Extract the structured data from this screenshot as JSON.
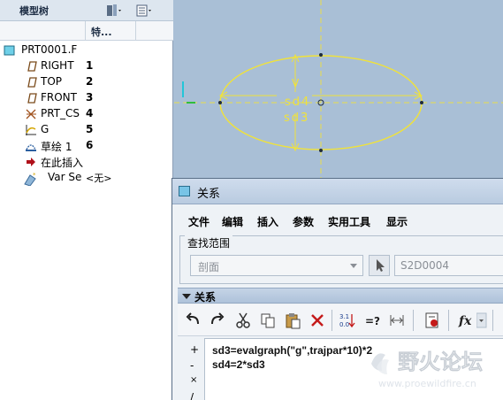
{
  "model_tree": {
    "title": "模型树",
    "column_header": "特...",
    "root": {
      "label": "PRT0001.F",
      "icon": "part-icon"
    },
    "rows": [
      {
        "name": "RIGHT",
        "value": "1",
        "icon": "datum-plane-icon"
      },
      {
        "name": "TOP",
        "value": "2",
        "icon": "datum-plane-icon"
      },
      {
        "name": "FRONT",
        "value": "3",
        "icon": "datum-plane-icon"
      },
      {
        "name": "PRT_CS",
        "value": "4",
        "icon": "coordinate-system-icon"
      },
      {
        "name": "G",
        "value": "5",
        "icon": "graph-icon"
      },
      {
        "name": "草绘 1",
        "value": "6",
        "icon": "sketch-icon"
      },
      {
        "name": "在此插入",
        "value": "",
        "icon": "insert-here-arrow-icon"
      },
      {
        "name": "Var Se",
        "value": "<无>",
        "icon": "variable-section-sweep-icon"
      }
    ]
  },
  "graphics": {
    "sketch_color": "#f0e23a",
    "dim_labels": [
      "sd4",
      "sd3"
    ],
    "axis_label": "V"
  },
  "dialog": {
    "title": "关系",
    "menu": [
      "文件",
      "编辑",
      "插入",
      "参数",
      "实用工具",
      "显示"
    ],
    "scope": {
      "group_label": "查找范围",
      "select_value": "剖面",
      "field_value": "S2D0004"
    },
    "relations_header": "关系",
    "toolbar_icons": [
      "undo-icon",
      "redo-icon",
      "cut-icon",
      "copy-icon",
      "paste-icon",
      "delete-icon",
      "sort-relations-icon",
      "evaluate-icon",
      "measure-icon",
      "verify-icon",
      "function-icon"
    ],
    "side_buttons": [
      "+",
      "-",
      "×",
      "/"
    ],
    "code_lines": [
      "sd3=evalgraph(\"g\",trajpar*10)*2",
      "sd4=2*sd3"
    ]
  },
  "watermark": {
    "title": "野火论坛",
    "url": "www.proewildfire.cn"
  }
}
